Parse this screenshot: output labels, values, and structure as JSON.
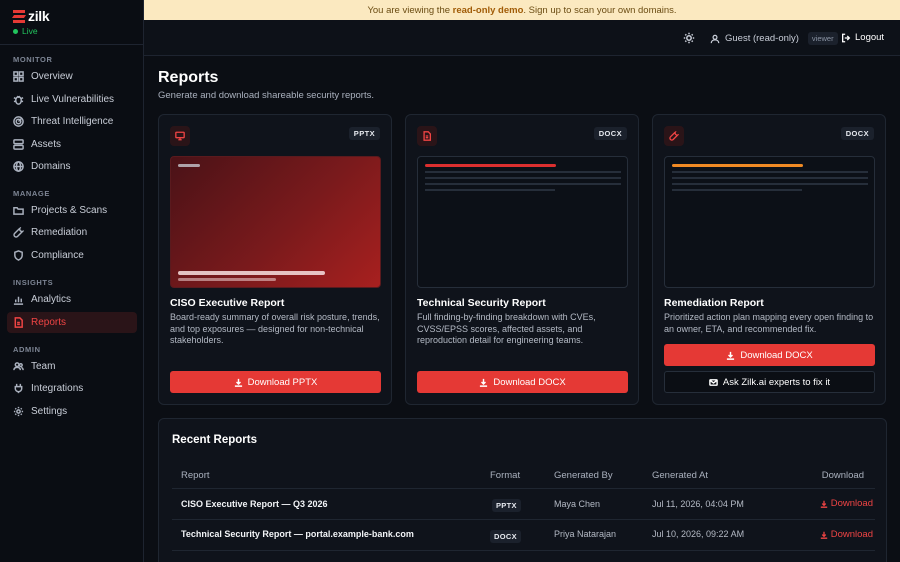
{
  "app": {
    "name": "zilk",
    "status": "Live"
  },
  "banner": {
    "prefix": "You are viewing the",
    "highlight": "read-only demo",
    "suffix": ". Sign up to scan your own domains."
  },
  "header": {
    "user": "Guest (read-only)",
    "role": "viewer",
    "logout": "Logout"
  },
  "sidebar": {
    "sections": [
      {
        "label": "MONITOR",
        "items": [
          {
            "label": "Overview",
            "icon": "grid-icon"
          },
          {
            "label": "Live Vulnerabilities",
            "icon": "bug-icon"
          },
          {
            "label": "Threat Intelligence",
            "icon": "radar-icon"
          },
          {
            "label": "Assets",
            "icon": "server-icon"
          },
          {
            "label": "Domains",
            "icon": "globe-icon"
          }
        ]
      },
      {
        "label": "MANAGE",
        "items": [
          {
            "label": "Projects & Scans",
            "icon": "folder-icon"
          },
          {
            "label": "Remediation",
            "icon": "wrench-icon"
          },
          {
            "label": "Compliance",
            "icon": "shield-icon"
          }
        ]
      },
      {
        "label": "INSIGHTS",
        "items": [
          {
            "label": "Analytics",
            "icon": "chart-icon"
          },
          {
            "label": "Reports",
            "icon": "file-icon",
            "active": true
          }
        ]
      },
      {
        "label": "ADMIN",
        "items": [
          {
            "label": "Team",
            "icon": "users-icon"
          },
          {
            "label": "Integrations",
            "icon": "plug-icon"
          },
          {
            "label": "Settings",
            "icon": "gear-icon"
          }
        ]
      }
    ]
  },
  "page": {
    "title": "Reports",
    "subtitle": "Generate and download shareable security reports."
  },
  "cards": [
    {
      "format": "PPTX",
      "title": "CISO Executive Report",
      "description": "Board-ready summary of overall risk posture, trends, and top exposures — designed for non-technical stakeholders.",
      "button": "Download PPTX",
      "icon": "presentation-icon"
    },
    {
      "format": "DOCX",
      "title": "Technical Security Report",
      "description": "Full finding-by-finding breakdown with CVEs, CVSS/EPSS scores, affected assets, and reproduction detail for engineering teams.",
      "button": "Download DOCX",
      "icon": "document-icon"
    },
    {
      "format": "DOCX",
      "title": "Remediation Report",
      "description": "Prioritized action plan mapping every open finding to an owner, ETA, and recommended fix.",
      "button": "Download DOCX",
      "secondary_button": "Ask Zilk.ai experts to fix it",
      "icon": "wrench-icon"
    }
  ],
  "recent": {
    "title": "Recent Reports",
    "columns": [
      "Report",
      "Format",
      "Generated By",
      "Generated At",
      "Download"
    ],
    "rows": [
      {
        "report": "CISO Executive Report — Q3 2026",
        "format": "PPTX",
        "by": "Maya Chen",
        "at": "Jul 11, 2026, 04:04 PM",
        "download": "Download"
      },
      {
        "report": "Technical Security Report — portal.example-bank.com",
        "format": "DOCX",
        "by": "Priya Natarajan",
        "at": "Jul 10, 2026, 09:22 AM",
        "download": "Download"
      }
    ]
  },
  "colors": {
    "accent": "#e53935",
    "live": "#22c55e",
    "banner": "#fbe9c0"
  }
}
